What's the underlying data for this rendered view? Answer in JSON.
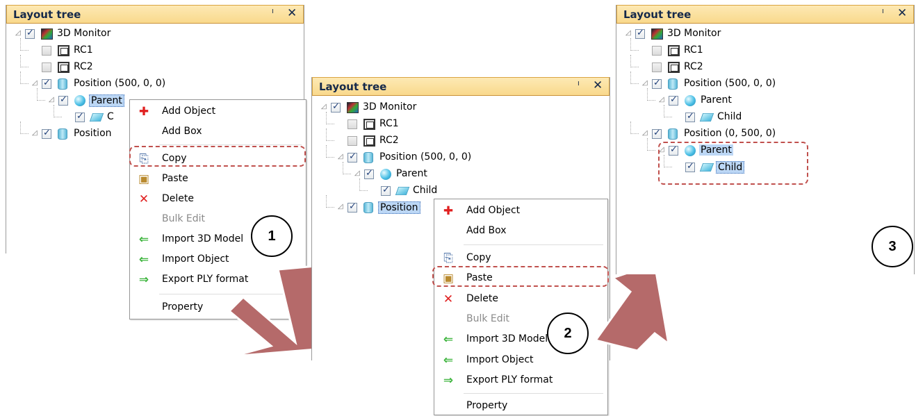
{
  "panel1": {
    "title": "Layout tree",
    "pin": "1̷",
    "close": "✕",
    "tree": [
      {
        "label": "3D Monitor",
        "icon": "monitor-icon",
        "checked": true
      },
      {
        "label": "RC1",
        "icon": "render-camera-icon",
        "checked": false
      },
      {
        "label": "RC2",
        "icon": "render-camera-icon",
        "checked": false
      },
      {
        "label": "Position (500, 0, 0)",
        "icon": "cylinder-icon",
        "checked": true
      },
      {
        "label": "Parent",
        "icon": "sphere-icon",
        "checked": true
      },
      {
        "label": "C",
        "icon": "box-icon",
        "checked": true
      },
      {
        "label": "Position",
        "icon": "cylinder-icon",
        "checked": true
      }
    ],
    "menu": [
      {
        "label": "Add Object",
        "icon": "add-object-icon",
        "enabled": true
      },
      {
        "label": "Add Box",
        "icon": "",
        "enabled": true
      },
      {
        "label": "Copy",
        "icon": "copy-icon",
        "enabled": true
      },
      {
        "label": "Paste",
        "icon": "paste-icon",
        "enabled": true
      },
      {
        "label": "Delete",
        "icon": "delete-icon",
        "enabled": true
      },
      {
        "label": "Bulk Edit",
        "icon": "",
        "enabled": false
      },
      {
        "label": "Import 3D Model",
        "icon": "import-arrow-icon",
        "enabled": true
      },
      {
        "label": "Import Object",
        "icon": "import-arrow-icon",
        "enabled": true
      },
      {
        "label": "Export PLY format",
        "icon": "export-arrow-icon",
        "enabled": true
      },
      {
        "label": "Property",
        "icon": "",
        "enabled": true
      }
    ],
    "step": "1"
  },
  "panel2": {
    "title": "Layout tree",
    "tree": [
      {
        "label": "3D Monitor",
        "checked": true
      },
      {
        "label": "RC1",
        "checked": false
      },
      {
        "label": "RC2",
        "checked": false
      },
      {
        "label": "Position (500, 0, 0)",
        "checked": true
      },
      {
        "label": "Parent",
        "checked": true
      },
      {
        "label": "Child",
        "checked": true
      },
      {
        "label": "Position",
        "checked": true
      }
    ],
    "step": "2"
  },
  "panel3": {
    "title": "Layout tree",
    "tree": [
      {
        "label": "3D Monitor",
        "checked": true
      },
      {
        "label": "RC1",
        "checked": false
      },
      {
        "label": "RC2",
        "checked": false
      },
      {
        "label": "Position (500, 0, 0)",
        "checked": true
      },
      {
        "label": "Parent",
        "checked": true
      },
      {
        "label": "Child",
        "checked": true
      },
      {
        "label": "Position (0, 500, 0)",
        "checked": true
      },
      {
        "label": "Parent",
        "checked": true
      },
      {
        "label": "Child",
        "checked": true
      }
    ],
    "step": "3"
  },
  "colors": {
    "title_bg": "#f9d98c",
    "selection": "#bcd7f5",
    "callout": "#c0504d",
    "arrow": "#b56a6a"
  }
}
